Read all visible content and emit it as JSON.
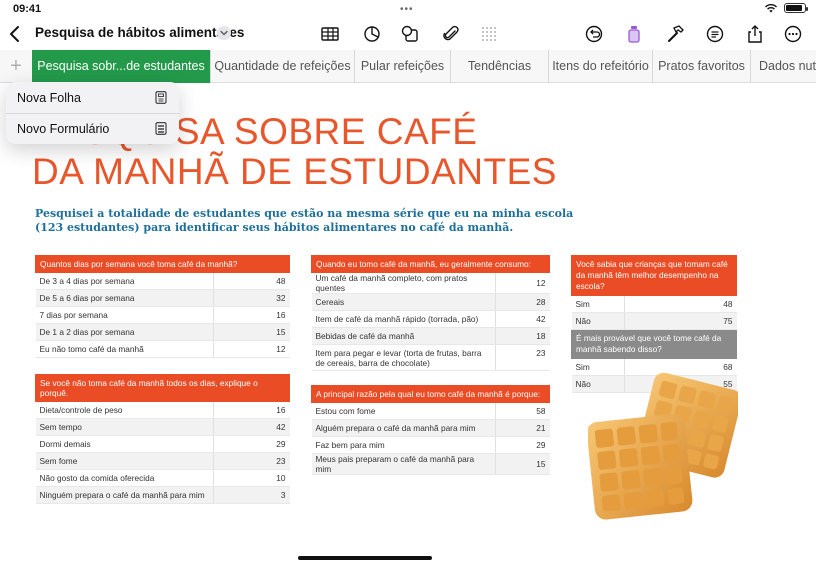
{
  "status": {
    "time": "09:41",
    "dots": "•••"
  },
  "toolbar": {
    "title": "Pesquisa de hábitos alimentares"
  },
  "tabs": [
    "Pesquisa sobr...de estudantes",
    "Quantidade de refeições",
    "Pular refeições",
    "Tendências",
    "Itens do refeitório",
    "Pratos favoritos",
    "Dados nutr"
  ],
  "add_sheet": "+",
  "popover": {
    "item1": "Nova Folha",
    "item2": "Novo Formulário"
  },
  "heading": {
    "line1": "PESQUISA SOBRE CAFÉ",
    "line2": "DA MANHÃ DE ESTUDANTES"
  },
  "subtitle": "Pesquisei a totalidade de estudantes que estão na mesma série que eu na minha escola (123 estudantes) para identificar seus hábitos alimentares no café da manhã.",
  "table1": {
    "header": "Quantos dias por semana você toma café da manhã?",
    "rows": [
      [
        "De 3 a 4 dias por semana",
        "48"
      ],
      [
        "De 5 a 6 dias por semana",
        "32"
      ],
      [
        "7 dias por semana",
        "16"
      ],
      [
        "De 1 a 2 dias por semana",
        "15"
      ],
      [
        "Eu não tomo café da manhã",
        "12"
      ]
    ]
  },
  "table2": {
    "header": "Se você não toma café da manhã todos os dias, explique o porquê.",
    "rows": [
      [
        "Dieta/controle de peso",
        "16"
      ],
      [
        "Sem tempo",
        "42"
      ],
      [
        "Dormi demais",
        "29"
      ],
      [
        "Sem fome",
        "23"
      ],
      [
        "Não gosto da comida oferecida",
        "10"
      ],
      [
        "Ninguém prepara o café da manhã para mim",
        "3"
      ]
    ]
  },
  "table3": {
    "header": "Quando eu tomo café da manhã, eu geralmente consumo:",
    "rows": [
      [
        "Um café da manhã completo, com pratos quentes",
        "12"
      ],
      [
        "Cereais",
        "28"
      ],
      [
        "Item de café da manhã rápido (torrada, pão)",
        "42"
      ],
      [
        "Bebidas de café da manhã",
        "18"
      ],
      [
        "Item para pegar e levar (torta de frutas, barra de cereais, barra de chocolate)",
        "23"
      ]
    ]
  },
  "table4": {
    "header": "A principal razão pela qual eu tomo café da manhã é porque:",
    "rows": [
      [
        "Estou com fome",
        "58"
      ],
      [
        "Alguém prepara o café da manhã para mim",
        "21"
      ],
      [
        "Faz bem para mim",
        "29"
      ],
      [
        "Meus pais preparam o café da manhã para mim",
        "15"
      ]
    ]
  },
  "table5": {
    "header": "Você sabia que crianças que tomam café da manhã têm melhor desempenho na escola?",
    "rows": [
      [
        "Sim",
        "48"
      ],
      [
        "Não",
        "75"
      ]
    ],
    "header2": "É mais provável que você tome café da manhã sabendo disso?",
    "rows2": [
      [
        "Sim",
        "68"
      ],
      [
        "Não",
        "55"
      ]
    ]
  },
  "colors": {
    "accent_orange": "#ea4c25",
    "tab_green": "#239a4a",
    "subtitle_blue": "#1e6f9a"
  }
}
